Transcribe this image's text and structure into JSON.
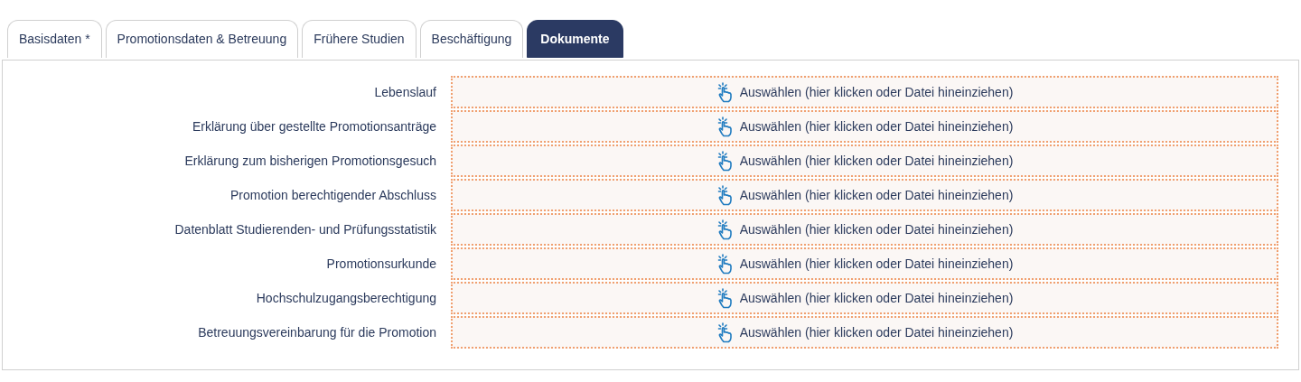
{
  "tabs": [
    {
      "label": "Basisdaten *",
      "selected": false
    },
    {
      "label": "Promotionsdaten & Betreuung",
      "selected": false
    },
    {
      "label": "Frühere Studien",
      "selected": false
    },
    {
      "label": "Beschäftigung",
      "selected": false
    },
    {
      "label": "Dokumente",
      "selected": true
    }
  ],
  "documents": [
    {
      "label": "Lebenslauf",
      "dropzone": "Auswählen (hier klicken oder Datei hineinziehen)"
    },
    {
      "label": "Erklärung über gestellte Promotionsanträge",
      "dropzone": "Auswählen (hier klicken oder Datei hineinziehen)"
    },
    {
      "label": "Erklärung zum bisherigen Promotionsgesuch",
      "dropzone": "Auswählen (hier klicken oder Datei hineinziehen)"
    },
    {
      "label": "Promotion berechtigender Abschluss",
      "dropzone": "Auswählen (hier klicken oder Datei hineinziehen)"
    },
    {
      "label": "Datenblatt Studierenden- und Prüfungsstatistik",
      "dropzone": "Auswählen (hier klicken oder Datei hineinziehen)"
    },
    {
      "label": "Promotionsurkunde",
      "dropzone": "Auswählen (hier klicken oder Datei hineinziehen)"
    },
    {
      "label": "Hochschulzugangsberechtigung",
      "dropzone": "Auswählen (hier klicken oder Datei hineinziehen)"
    },
    {
      "label": "Betreuungsvereinbarung für die Promotion",
      "dropzone": "Auswählen (hier klicken oder Datei hineinziehen)"
    }
  ]
}
